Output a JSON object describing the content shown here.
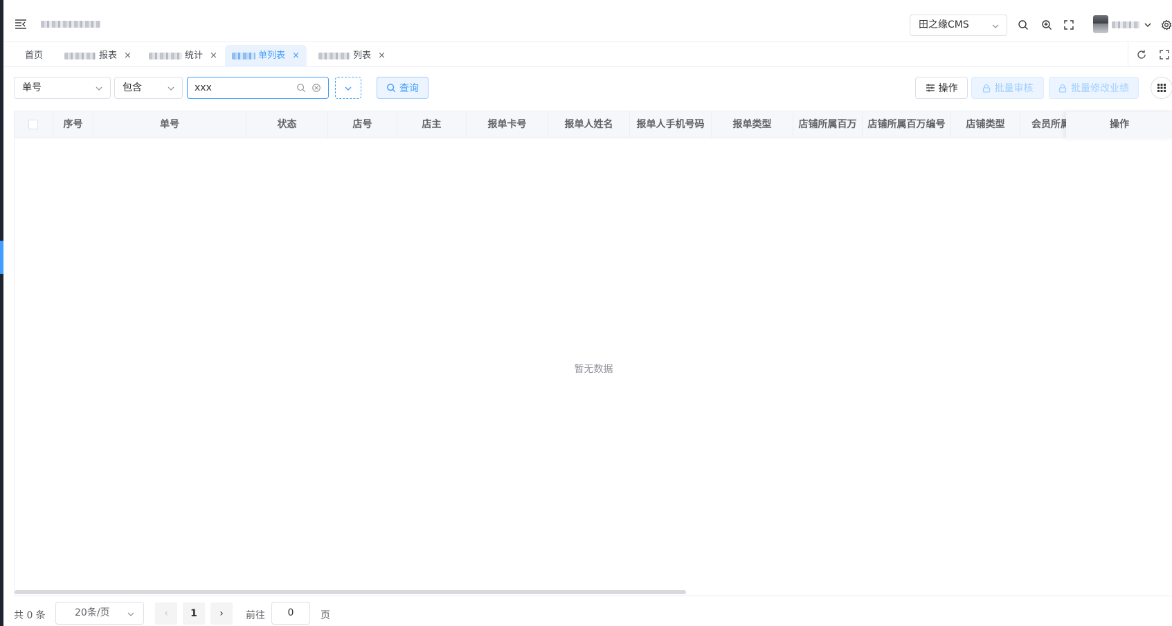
{
  "header": {
    "system_select": "田之缘CMS",
    "icons": [
      "menu-fold-icon",
      "search-icon",
      "zoom-in-icon",
      "fullscreen-icon",
      "chevron-down-icon",
      "gear-icon"
    ]
  },
  "tabs": [
    {
      "label": "首页",
      "closable": false,
      "active": false
    },
    {
      "label": "报表",
      "closable": true,
      "active": false
    },
    {
      "label": "统计",
      "closable": true,
      "active": false
    },
    {
      "label": "单列表",
      "closable": true,
      "active": true
    },
    {
      "label": "列表",
      "closable": true,
      "active": false
    }
  ],
  "tab_close": "×",
  "filter": {
    "field": "单号",
    "operator": "包含",
    "value": "xxx",
    "query_label": "查询",
    "operation_label": "操作",
    "batch_review_label": "批量审核",
    "batch_edit_label": "批量修改业绩"
  },
  "table": {
    "columns": [
      "序号",
      "单号",
      "状态",
      "店号",
      "店主",
      "报单卡号",
      "报单人姓名",
      "报单人手机号码",
      "报单类型",
      "店铺所属百万",
      "店铺所属百万编号",
      "店铺类型",
      "会员所属",
      "操作"
    ],
    "empty_text": "暂无数据"
  },
  "pagination": {
    "total_text": "共 0 条",
    "page_size": "20条/页",
    "prev": "‹",
    "current_page": "1",
    "next": "›",
    "goto_label": "前往",
    "goto_value": "0",
    "page_unit": "页"
  },
  "colors": {
    "accent": "#409eff",
    "accent_light": "#ecf5ff",
    "border": "#dcdfe6",
    "sidebar": "#1f2430"
  }
}
